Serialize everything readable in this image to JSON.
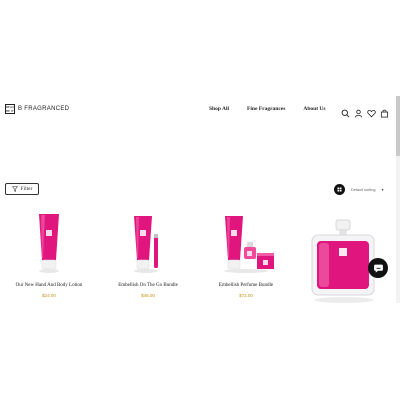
{
  "header": {
    "logo_text": "B FRAGRANCED",
    "logo_mark": [
      "BE",
      "AU",
      "BE",
      "IT"
    ],
    "nav": [
      "Shop All",
      "Fine Fragrances",
      "About Us"
    ]
  },
  "toolbar": {
    "filter_label": "Filter",
    "sort_label": "Default sorting"
  },
  "products": [
    {
      "name": "Our New Hand And Body Lotion",
      "price": "$24.00"
    },
    {
      "name": "Embellish On The Go Bundle",
      "price": "$46.00"
    },
    {
      "name": "Embellish Perfume Bundle",
      "price": "$72.00"
    },
    {
      "name": "",
      "price": ""
    }
  ],
  "colors": {
    "brand_pink": "#e0157e",
    "price_gold": "#c5951a"
  }
}
